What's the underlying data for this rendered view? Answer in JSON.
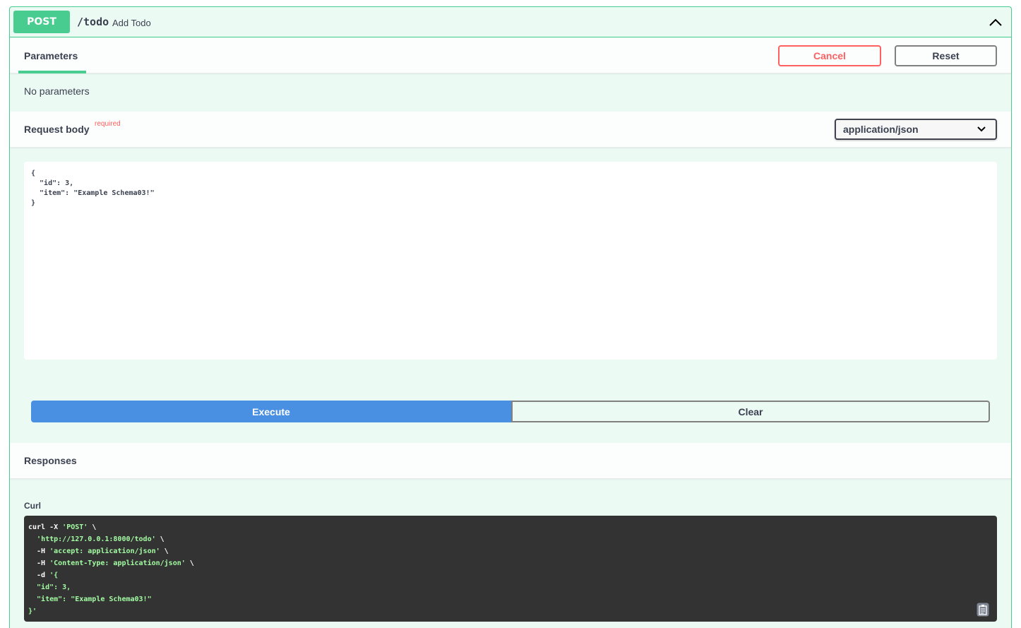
{
  "operation": {
    "method": "POST",
    "path": "/todo",
    "summary": "Add Todo"
  },
  "parameters": {
    "tab_label": "Parameters",
    "cancel_label": "Cancel",
    "reset_label": "Reset",
    "empty_text": "No parameters"
  },
  "request_body": {
    "title": "Request body",
    "required_label": "required",
    "content_type": "application/json",
    "value": "{\n  \"id\": 3,\n  \"item\": \"Example Schema03!\"\n}"
  },
  "actions": {
    "execute_label": "Execute",
    "clear_label": "Clear"
  },
  "responses": {
    "title": "Responses",
    "curl_label": "Curl",
    "curl_lines": [
      [
        {
          "t": "curl -X ",
          "c": "w"
        },
        {
          "t": "'POST'",
          "c": "g"
        },
        {
          "t": " \\",
          "c": "w"
        }
      ],
      [
        {
          "t": "  ",
          "c": "w"
        },
        {
          "t": "'http://127.0.0.1:8000/todo'",
          "c": "g"
        },
        {
          "t": " \\",
          "c": "w"
        }
      ],
      [
        {
          "t": "  -H ",
          "c": "w"
        },
        {
          "t": "'accept: application/json'",
          "c": "g"
        },
        {
          "t": " \\",
          "c": "w"
        }
      ],
      [
        {
          "t": "  -H ",
          "c": "w"
        },
        {
          "t": "'Content-Type: application/json'",
          "c": "g"
        },
        {
          "t": " \\",
          "c": "w"
        }
      ],
      [
        {
          "t": "  -d ",
          "c": "w"
        },
        {
          "t": "'{",
          "c": "g"
        }
      ],
      [
        {
          "t": "  \"id\": 3,",
          "c": "g"
        }
      ],
      [
        {
          "t": "  \"item\": \"Example Schema03!\"",
          "c": "g"
        }
      ],
      [
        {
          "t": "}'",
          "c": "g"
        }
      ]
    ]
  },
  "icons": {
    "collapse": "chevron-up-icon",
    "select_arrow": "chevron-down-icon",
    "copy": "copy-to-clipboard-icon"
  },
  "colors": {
    "post_green": "#49cc90",
    "cancel_red": "#ff6060",
    "execute_blue": "#4990e2",
    "curl_bg": "#333333",
    "curl_string": "#a2fca2"
  }
}
